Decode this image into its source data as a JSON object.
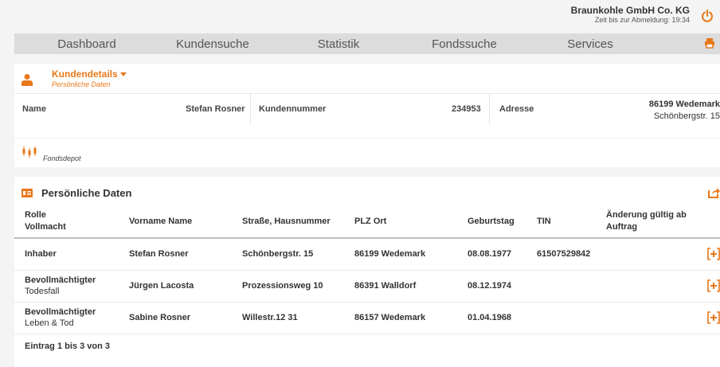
{
  "header": {
    "company": "Braunkohle GmbH Co. KG",
    "session": "Zeit bis zur Abmeldung: 19:34"
  },
  "nav": {
    "items": [
      "Dashboard",
      "Kundensuche",
      "Statistik",
      "Fondssuche",
      "Services"
    ]
  },
  "kundendetails": {
    "title": "Kundendetails",
    "subtitle": "Persönliche Daten",
    "name_label": "Name",
    "name_value": "Stefan Rosner",
    "kundennummer_label": "Kundennummer",
    "kundennummer_value": "234953",
    "adresse_label": "Adresse",
    "adresse_line1": "86199 Wedemark",
    "adresse_line2": "Schönbergstr. 15"
  },
  "fondsdepot": {
    "label": "Fondsdepot"
  },
  "persoenliche_daten": {
    "title": "Persönliche Daten",
    "columns": {
      "rolle": "Rolle",
      "vollmacht": "Vollmacht",
      "name": "Vorname Name",
      "strasse": "Straße, Hausnummer",
      "plz": "PLZ Ort",
      "geburtstag": "Geburtstag",
      "tin": "TIN",
      "aenderung": "Änderung gültig ab",
      "auftrag": "Auftrag"
    },
    "rows": [
      {
        "rolle": "Inhaber",
        "vollmacht": "",
        "name": "Stefan Rosner",
        "strasse": "Schönbergstr. 15",
        "plz": "86199 Wedemark",
        "geburtstag": "08.08.1977",
        "tin": "61507529842"
      },
      {
        "rolle": "Bevollmächtigter",
        "vollmacht": "Todesfall",
        "name": "Jürgen Lacosta",
        "strasse": "Prozessionsweg 10",
        "plz": "86391 Walldorf",
        "geburtstag": "08.12.1974",
        "tin": ""
      },
      {
        "rolle": "Bevollmächtigter",
        "vollmacht": "Leben & Tod",
        "name": "Sabine Rosner",
        "strasse": "Willestr.12 31",
        "plz": "86157 Wedemark",
        "geburtstag": "01.04.1968",
        "tin": ""
      }
    ],
    "footer": "Eintrag 1 bis 3 von 3"
  },
  "colors": {
    "accent": "#e8781a",
    "nav_bg": "#dcdcdc",
    "page_bg": "#f4f4f4"
  },
  "icons": [
    "power-icon",
    "printer-icon",
    "user-icon",
    "candlestick-icon",
    "id-card-icon",
    "share-icon",
    "add-icon"
  ]
}
